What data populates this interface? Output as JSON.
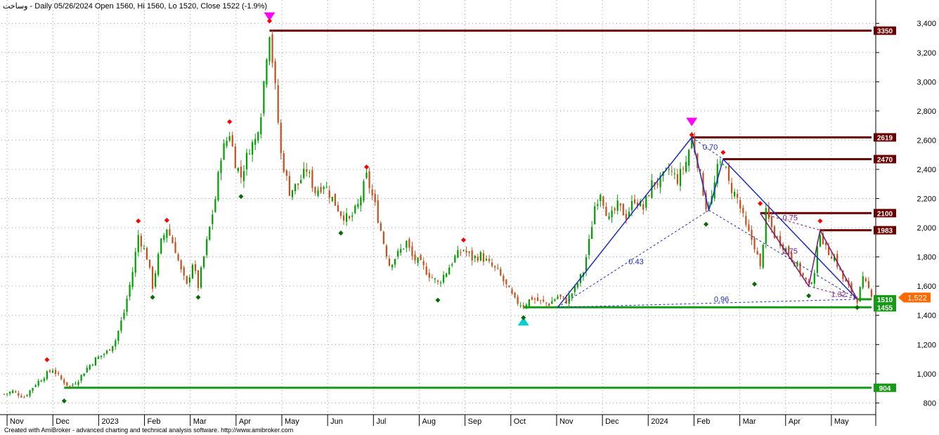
{
  "header": {
    "symbol": "وساخت",
    "text": " - Daily 05/26/2024 Open 1560, Hi 1560, Lo 1520, Close 1522 (-1.9%)"
  },
  "footer": {
    "text": "Created with AmiBroker - advanced charting and technical analysis software. http://www.amibroker.com"
  },
  "colors": {
    "up": "#00a000",
    "down": "#c8501e",
    "grid": "#a0a0a0",
    "resistance": "#6b0000",
    "support": "#179a17",
    "pattern": "#1c2bbf",
    "pattern2": "#7a1a7a",
    "marker_top": "#ff00ff",
    "marker_bottom": "#00d0d0",
    "last_price": "#ff6a00"
  },
  "chart_data": {
    "type": "candlestick",
    "ylim": [
      720,
      3560
    ],
    "y_ticks": [
      800,
      1000,
      1200,
      1400,
      1600,
      1800,
      2000,
      2200,
      2400,
      2600,
      2800,
      3000,
      3200,
      3400
    ],
    "y_tick_labels": [
      "800",
      "1,000",
      "1,200",
      "1,400",
      "1,600",
      "1,800",
      "2,000",
      "2,200",
      "2,400",
      "2,600",
      "2,800",
      "3,000",
      "3,200",
      "3,400"
    ],
    "grid": true,
    "x_months": [
      "Nov",
      "Dec",
      "2023",
      "Feb",
      "Mar",
      "Apr",
      "May",
      "Jun",
      "Jul",
      "Aug",
      "Sep",
      "Oct",
      "Nov",
      "Dec",
      "2024",
      "Feb",
      "Mar",
      "Apr",
      "May"
    ],
    "price_path": [
      [
        0,
        860
      ],
      [
        3,
        880
      ],
      [
        7,
        840
      ],
      [
        11,
        930
      ],
      [
        15,
        1000
      ],
      [
        17,
        1030
      ],
      [
        20,
        960
      ],
      [
        23,
        910
      ],
      [
        26,
        960
      ],
      [
        29,
        1040
      ],
      [
        32,
        1100
      ],
      [
        36,
        1150
      ],
      [
        39,
        1230
      ],
      [
        42,
        1420
      ],
      [
        45,
        1700
      ],
      [
        47,
        1950
      ],
      [
        50,
        1800
      ],
      [
        52,
        1600
      ],
      [
        55,
        1900
      ],
      [
        57,
        2000
      ],
      [
        60,
        1850
      ],
      [
        62,
        1700
      ],
      [
        64,
        1600
      ],
      [
        66,
        1760
      ],
      [
        68,
        1600
      ],
      [
        71,
        1900
      ],
      [
        74,
        2200
      ],
      [
        76,
        2500
      ],
      [
        79,
        2650
      ],
      [
        81,
        2450
      ],
      [
        83,
        2350
      ],
      [
        86,
        2550
      ],
      [
        88,
        2600
      ],
      [
        90,
        2800
      ],
      [
        92,
        3200
      ],
      [
        93,
        3350
      ],
      [
        95,
        2950
      ],
      [
        97,
        2500
      ],
      [
        100,
        2250
      ],
      [
        103,
        2300
      ],
      [
        106,
        2400
      ],
      [
        109,
        2250
      ],
      [
        112,
        2300
      ],
      [
        115,
        2200
      ],
      [
        118,
        2100
      ],
      [
        121,
        2050
      ],
      [
        124,
        2150
      ],
      [
        127,
        2350
      ],
      [
        130,
        2150
      ],
      [
        133,
        1900
      ],
      [
        135,
        1750
      ],
      [
        138,
        1820
      ],
      [
        141,
        1900
      ],
      [
        143,
        1800
      ],
      [
        146,
        1750
      ],
      [
        149,
        1680
      ],
      [
        152,
        1620
      ],
      [
        155,
        1700
      ],
      [
        158,
        1800
      ],
      [
        161,
        1850
      ],
      [
        164,
        1790
      ],
      [
        167,
        1810
      ],
      [
        170,
        1750
      ],
      [
        173,
        1700
      ],
      [
        176,
        1600
      ],
      [
        179,
        1500
      ],
      [
        182,
        1470
      ],
      [
        185,
        1520
      ],
      [
        188,
        1490
      ],
      [
        191,
        1480
      ],
      [
        194,
        1530
      ],
      [
        197,
        1500
      ],
      [
        200,
        1580
      ],
      [
        203,
        1700
      ],
      [
        205,
        1900
      ],
      [
        207,
        2150
      ],
      [
        209,
        2250
      ],
      [
        212,
        2050
      ],
      [
        215,
        2150
      ],
      [
        218,
        2080
      ],
      [
        221,
        2200
      ],
      [
        224,
        2130
      ],
      [
        227,
        2300
      ],
      [
        230,
        2320
      ],
      [
        233,
        2400
      ],
      [
        236,
        2330
      ],
      [
        239,
        2450
      ],
      [
        241,
        2619
      ],
      [
        243,
        2450
      ],
      [
        246,
        2150
      ],
      [
        248,
        2200
      ],
      [
        250,
        2400
      ],
      [
        252,
        2470
      ],
      [
        254,
        2300
      ],
      [
        257,
        2200
      ],
      [
        260,
        2000
      ],
      [
        263,
        1880
      ],
      [
        265,
        1720
      ],
      [
        267,
        2100
      ],
      [
        270,
        1950
      ],
      [
        273,
        1880
      ],
      [
        276,
        1800
      ],
      [
        279,
        1700
      ],
      [
        282,
        1600
      ],
      [
        284,
        1700
      ],
      [
        286,
        1983
      ],
      [
        288,
        1850
      ],
      [
        291,
        1800
      ],
      [
        294,
        1650
      ],
      [
        297,
        1560
      ],
      [
        299,
        1510
      ],
      [
        301,
        1640
      ],
      [
        303,
        1580
      ],
      [
        305,
        1522
      ]
    ],
    "levels": [
      {
        "price": 3350,
        "label": "3350",
        "kind": "resistance"
      },
      {
        "price": 2619,
        "label": "2619",
        "kind": "resistance"
      },
      {
        "price": 2470,
        "label": "2470",
        "kind": "resistance"
      },
      {
        "price": 2100,
        "label": "2100",
        "kind": "resistance"
      },
      {
        "price": 1983,
        "label": "1983",
        "kind": "resistance"
      },
      {
        "price": 1510,
        "label": "1510",
        "kind": "support"
      },
      {
        "price": 1455,
        "label": "1455",
        "kind": "support"
      },
      {
        "price": 904,
        "label": "904",
        "kind": "support"
      }
    ],
    "last_price": {
      "value": 1522,
      "label": "1,522"
    },
    "pattern_points": {
      "X": [
        194,
        1455
      ],
      "A": [
        241,
        2619
      ],
      "B": [
        247,
        2120
      ],
      "C": [
        252,
        2470
      ],
      "D": [
        299,
        1510
      ]
    },
    "ratios": [
      {
        "label": "0.70",
        "kind": "pattern"
      },
      {
        "label": "0.43",
        "kind": "pattern"
      },
      {
        "label": "0.96",
        "kind": "pattern"
      },
      {
        "label": "0.75",
        "kind": "pattern2"
      },
      {
        "label": "2.75",
        "kind": "pattern2"
      },
      {
        "label": "1.32",
        "kind": "pattern2"
      }
    ]
  }
}
